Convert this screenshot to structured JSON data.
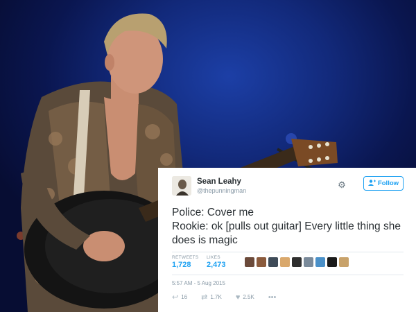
{
  "tweet": {
    "user_name": "Sean Leahy",
    "user_handle": "@thepunningman",
    "follow_label": "Follow",
    "text_lines": [
      "Police: Cover me",
      "Rookie: ok [pulls out guitar] Every little thing she",
      "does is magic"
    ],
    "retweets_label": "RETWEETS",
    "retweets_count": "1,728",
    "likes_label": "LIKES",
    "likes_count": "2,473",
    "timestamp": "5:57 AM - 5 Aug 2015",
    "reply_count": "16",
    "retweet_action_count": "1.7K",
    "like_action_count": "2.5K",
    "more_label": "•••"
  },
  "icons": {
    "gear": "gear-icon",
    "follow": "add-user-icon",
    "reply": "reply-icon",
    "retweet": "retweet-icon",
    "like": "heart-icon",
    "more": "more-icon"
  },
  "colors": {
    "accent": "#1da1f2",
    "muted": "#8899a6",
    "text": "#292f33",
    "background_stage": "#12297a"
  },
  "liker_avatars": [
    "#6b4a3a",
    "#8a5a3c",
    "#3e4b58",
    "#d9a86c",
    "#2f2f2f",
    "#7a8a9a",
    "#4a90c8",
    "#1a1a1a",
    "#c8a26a"
  ]
}
